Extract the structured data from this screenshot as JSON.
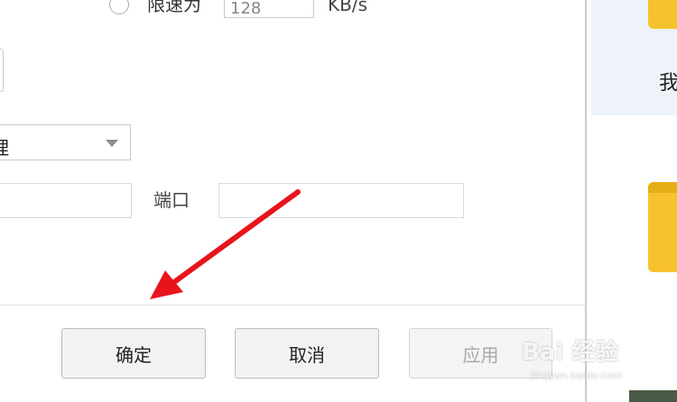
{
  "speed_limit": {
    "label": "限速为",
    "value": "128",
    "unit": "KB/s"
  },
  "proxy": {
    "type_value": "理",
    "address_value": "",
    "port_label": "端口",
    "port_value": ""
  },
  "buttons": {
    "ok": "确定",
    "cancel": "取消",
    "apply": "应用"
  },
  "background": {
    "right_text": "我"
  },
  "watermark": {
    "main": "Bai 经验",
    "sub": "jingyan.baidu.com"
  },
  "colors": {
    "arrow": "#e8141b",
    "accent_tile": "#f7c22e"
  }
}
